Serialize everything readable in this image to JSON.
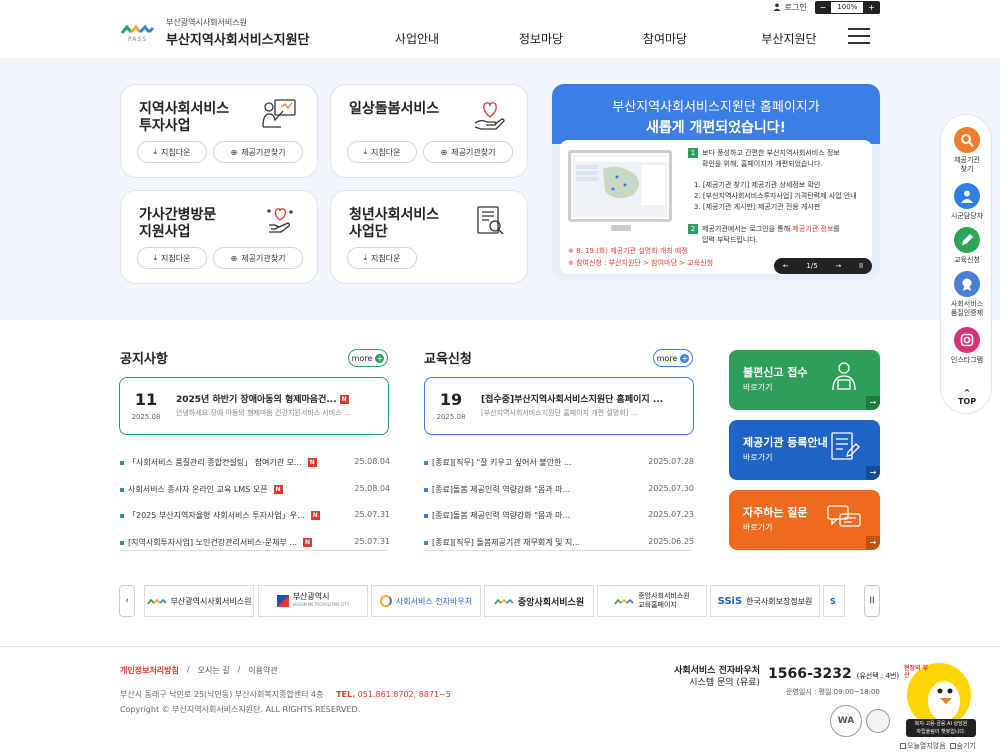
{
  "utility": {
    "login_label": "로그인",
    "zoom_minus": "−",
    "zoom_value": "100%",
    "zoom_plus": "+"
  },
  "header": {
    "org_small": "부산광역시사회서비스원",
    "org_name": "부산지역사회서비스지원단",
    "logo_sub": "PASS",
    "nav": [
      "사업안내",
      "정보마당",
      "참여마당",
      "부산지원단"
    ]
  },
  "cards": [
    {
      "title": "지역사회서비스\n투자사업",
      "icon": "presenter-board-icon",
      "buttons": [
        "지침다운",
        "제공기관찾기"
      ]
    },
    {
      "title": "일상돌봄서비스",
      "icon": "hand-heart-icon",
      "buttons": [
        "지침다운",
        "제공기관찾기"
      ]
    },
    {
      "title": "가사간병방문\n지원사업",
      "icon": "care-hand-icon",
      "buttons": [
        "지침다운",
        "제공기관찾기"
      ]
    },
    {
      "title": "청년사회서비스\n사업단",
      "icon": "document-search-icon",
      "buttons": [
        "지침다운"
      ]
    }
  ],
  "banner": {
    "line1": "부산지역사회서비스지원단 홈페이지가",
    "line2": "새롭게 개편되었습니다!",
    "point1_num": "1",
    "point1_a": "보다 풍성하고 간편한 부산지역사회서비스 정보",
    "point1_b": "확인을 위해, 홈페이지가 개편되었습니다.",
    "items": [
      "1. [제공기관 찾기] 제공기관 상세정보 확인",
      "2. [부산지역사회서비스투자사업] 가격탄력제 사업 안내",
      "3. [제공기관 게시판] 제공기관 전용 게시판"
    ],
    "point2_num": "2",
    "point2_a_pre": "제공기관에서는 로그인을 통해 ",
    "point2_a_hl": "제공기관 정보",
    "point2_a_post": "를",
    "point2_b": "입력 부탁드립니다.",
    "note1": "※ 8. 19.(화) 제공기관 설명회 개최 예정",
    "note2": "※ 참여신청 : 부산지원단 > 참여마당 > 교육신청",
    "prev": "←",
    "pager": "1/5",
    "next": "→",
    "pause": "II"
  },
  "quick": {
    "items": [
      {
        "label": "제공기관\n찾기",
        "icon": "search-icon",
        "color": "#f07d2a"
      },
      {
        "label": "시군담당자",
        "icon": "user-icon",
        "color": "#2f7ee8"
      },
      {
        "label": "교육신청",
        "icon": "pencil-icon",
        "color": "#2ea35a"
      },
      {
        "label": "사회서비스\n품질인증제",
        "icon": "badge-icon",
        "color": "#4a7fd6"
      },
      {
        "label": "인스타그램",
        "icon": "instagram-icon",
        "color": "#d8327a"
      }
    ],
    "top_label": "TOP"
  },
  "notice": {
    "title": "공지사항",
    "more": "more",
    "featured": {
      "day": "11",
      "ym": "2025.08",
      "title": "2025년 하반기 장애아동의 형제마음건...",
      "summary": "안녕하세요.장애 아동의 형제마음 건강지원서비스 서비스 ..."
    },
    "items": [
      {
        "text": "「사회서비스 품질관리 종합컨설팅」 참여기관 모...",
        "new": "N",
        "date": "25.08.04"
      },
      {
        "text": "사회서비스 종사자 온라인 교육 LMS 오픈",
        "new": "N",
        "date": "25.08.04"
      },
      {
        "text": "「2025 부산지역자율형 사회서비스 투자사업」우...",
        "new": "N",
        "date": "25.07.31"
      },
      {
        "text": "[지역사회투자사업] 노인건강관리서비스-문체부 ...",
        "new": "N",
        "date": "25.07.31"
      }
    ]
  },
  "edu": {
    "title": "교육신청",
    "more": "more",
    "featured": {
      "day": "19",
      "ym": "2025.08",
      "title": "[접수중]부산지역사회서비스지원단 홈페이지 ...",
      "summary": "[부산지역사회서비스지원단 홈페이지 개편 설명회] ..."
    },
    "items": [
      {
        "text": "[종료][직무] \"잘 키우고 싶어서 불안한 ...",
        "date": "2025.07.28"
      },
      {
        "text": "[종료]돌봄 제공인력 역량강화 \"몸과 마...",
        "date": "2025.07.30"
      },
      {
        "text": "[종료]돌봄 제공인력 역량강화 \"몸과 마...",
        "date": "2025.07.23"
      },
      {
        "text": "[종료][직무] 돌봄제공기관 재무회계 및 지...",
        "date": "2025.06.25"
      }
    ]
  },
  "side_banners": [
    {
      "title": "불편신고 접수",
      "sub": "바로가기",
      "color": "#2e9f5a",
      "icon": "report-person-icon"
    },
    {
      "title": "제공기관 등록안내",
      "sub": "바로가기",
      "color": "#1f63c6",
      "icon": "register-doc-icon"
    },
    {
      "title": "자주하는 질문",
      "sub": "바로가기",
      "color": "#ef6a1e",
      "icon": "faq-chat-icon"
    }
  ],
  "family": {
    "prev": "‹",
    "pause": "II",
    "sites": [
      "부산광역시사회서비스원",
      "부산광역시",
      "사회서비스 전자바우처",
      "중앙사회서비스원",
      "중앙사회서비스원\n교육홈페이지",
      "한국사회보장정보원"
    ],
    "sites_sub": [
      "",
      "BUSAN METROPOLITAN CITY",
      "",
      "",
      "",
      ""
    ]
  },
  "footer": {
    "links": [
      "개인정보처리방침",
      "오시는 길",
      "이용약관"
    ],
    "address": "부산시 동래구 낙민로 25(낙민동) 부산사회복지종합센터 4층",
    "tel_label": "TEL.",
    "tel": "051.861.8702, 8871~5",
    "copyright": "Copyright © 부산지역사회서비스지원단. ALL RIGHTS RESERVED.",
    "phone_label1": "사회서비스 전자바우처",
    "phone_label2": "시스템 문의 (유료)",
    "phone": "1566-3232",
    "phone_ext": "(유선택 : 4번)",
    "hours": "운영일시 : 평일 09:00~18:00",
    "wa_text": "WA",
    "mascot_bubble": "현장의 부산",
    "chat_note": "복지·고용·금융 AI 상담원\n자립울림이 챗봇입니다.",
    "chk1": "오늘열지않음",
    "chk2": "숨기기"
  }
}
